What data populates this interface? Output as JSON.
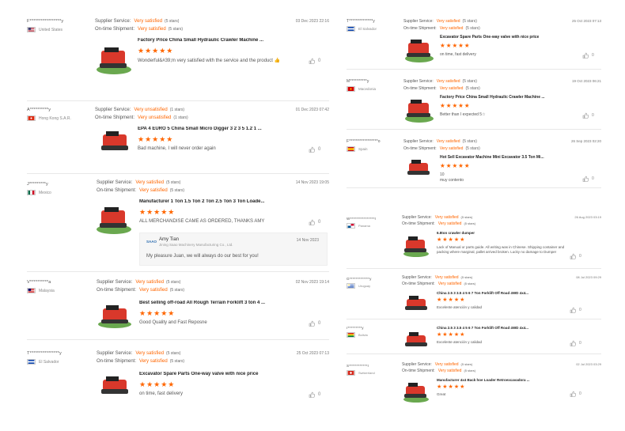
{
  "labels": {
    "supplier_service": "Supplier Service:",
    "on_time_shipment": "On-time Shipment:"
  },
  "colors": {
    "accent": "#ff6600"
  },
  "left": [
    {
      "user": "F*****************y",
      "country": "United States",
      "flag": "us",
      "service": "Very satisfied",
      "service_stars": "(5 stars)",
      "shipment": "Very satisfied",
      "shipment_stars": "(5 stars)",
      "date": "03 Dec 2023 22:16",
      "product": "Factory Price China Small Hydraulic Crawler Machine ...",
      "stars": "★★★★★",
      "comment": "Wonderful&#39;m very satisfied with the service and the product 👍",
      "likes": "0"
    },
    {
      "user": "A**********y",
      "country": "Hong Kong S.A.R.",
      "flag": "hk",
      "service": "Very unsatisfied",
      "service_stars": "(1 stars)",
      "shipment": "Very unsatisfied",
      "shipment_stars": "(1 stars)",
      "date": "01 Dec 2023 07:42",
      "product": "EPA 4 EURO 5 China Small Micro Digger 3 2 3 5 1.2 1 ...",
      "stars": "★★★★★",
      "comment": "Bad machine, I will never order again",
      "likes": "0"
    },
    {
      "user": "J*********y",
      "country": "Mexico",
      "flag": "mx",
      "service": "Very satisfied",
      "service_stars": "(5 stars)",
      "shipment": "Very satisfied",
      "shipment_stars": "(5 stars)",
      "date": "14 Nov 2023 19:05",
      "product": "Manufacturer 1 Ton 1.5 Ton 2 Ton 2.5 Ton 3 Ton Loade...",
      "stars": "★★★★★",
      "comment": "ALL MERCHANDISE CAME AS ORDERED, THANKS AMY",
      "likes": "0",
      "reply": {
        "logo": "SAAO",
        "name": "Amy Tian",
        "company": "Jining Saao Machinery Manufacturing Co., Ltd.",
        "date": "14 Nov 2023",
        "text": "My pleasure Juan, we will always do our best for you!"
      }
    },
    {
      "user": "V**********a",
      "country": "Malaysia",
      "flag": "my",
      "service": "Very satisfied",
      "service_stars": "(5 stars)",
      "shipment": "Very satisfied",
      "shipment_stars": "(5 stars)",
      "date": "02 Nov 2023 19:14",
      "product": "Best selling off-road All Rough Terrain Forklift 3 ton 4 ...",
      "stars": "★★★★★",
      "comment": "Good Quality and Fast Reposne",
      "likes": "0"
    },
    {
      "user": "T****************y",
      "country": "El Salvador",
      "flag": "sv",
      "service": "Very satisfied",
      "service_stars": "(5 stars)",
      "shipment": "Very satisfied",
      "shipment_stars": "(5 stars)",
      "date": "25 Oct 2023 07:13",
      "product": "Excavator Spare Parts One-way valve with nice price",
      "stars": "★★★★★",
      "comment": "on time, fast delivery",
      "likes": "0"
    }
  ],
  "right": [
    {
      "user": "T**************y",
      "country": "El Salvador",
      "flag": "sv",
      "service": "Very satisfied",
      "service_stars": "(5 stars)",
      "shipment": "Very satisfied",
      "shipment_stars": "(5 stars)",
      "date": "25 Oct 2023 07:13",
      "product": "Excavator Spare Parts One-way valve with nice price",
      "stars": "★★★★★",
      "comment": "on time, fast delivery",
      "likes": "0"
    },
    {
      "user": "M**********y",
      "country": "Macedonia",
      "flag": "mk",
      "service": "Very satisfied",
      "service_stars": "(5 stars)",
      "shipment": "Very satisfied",
      "shipment_stars": "(5 stars)",
      "date": "19 Oct 2023 06:21",
      "product": "Factory Price China Small Hydraulic Crawler Machine ...",
      "stars": "★★★★★",
      "comment": "Better than I expected 5☆",
      "likes": "0"
    },
    {
      "user": "F*****************o",
      "country": "Spain",
      "flag": "es",
      "service": "Very satisfied",
      "service_stars": "(5 stars)",
      "shipment": "Very satisfied",
      "shipment_stars": "(5 stars)",
      "date": "26 Sep 2023 02:20",
      "product": "Hot Sell Excavator Machine Mini Excavator 3.5 Ton Mi...",
      "stars": "★★★★★",
      "comment": "10\nmuy contento",
      "likes": "0"
    },
    {
      "user": "W****************r",
      "country": "Panama",
      "flag": "pa",
      "service": "Very satisfied",
      "service_stars": "(5 stars)",
      "shipment": "Very satisfied",
      "shipment_stars": "(5 stars)",
      "date": "26 Aug 2023 03:19",
      "product": "6.8ton crawler dumper",
      "stars": "★★★★★",
      "comment": "Lack of Manual or parts guide. All writing was in Chinese. Shipping container and packing where marginal, pallet arrived broken. Lucky no damage to Dumper",
      "likes": "0"
    },
    {
      "user": "G*************y",
      "country": "Uruguay",
      "flag": "uy",
      "service": "Very satisfied",
      "service_stars": "(5 stars)",
      "shipment": "Very satisfied",
      "shipment_stars": "(5 stars)",
      "date": "08 Jul 2023 09:29",
      "product": "China 2.5 3 3.5 4 5 6 7 Ton Forklift Off Road 4WD 4x4...",
      "stars": "★★★★★",
      "comment": "Excelente atención y calidad",
      "likes": "0"
    },
    {
      "user": "r*********y",
      "country": "Bolivia",
      "flag": "bo",
      "service": "",
      "service_stars": "",
      "shipment": "",
      "shipment_stars": "",
      "date": "",
      "product": "China 2.5 3 3.5 4 5 6 7 Ton Forklift Off Road 4WD 4x4...",
      "stars": "★★★★★",
      "comment": "Excelente atención y calidad",
      "likes": "0"
    },
    {
      "user": "S************r",
      "country": "Switzerland",
      "flag": "ch",
      "service": "Very satisfied",
      "service_stars": "(5 stars)",
      "shipment": "Very satisfied",
      "shipment_stars": "(5 stars)",
      "date": "02 Jul 2023 03:29",
      "product": "Manufacturer 4x4 Back hoe Loader Retroexcavadora ...",
      "stars": "★★★★★",
      "comment": "Great",
      "likes": "0"
    }
  ]
}
